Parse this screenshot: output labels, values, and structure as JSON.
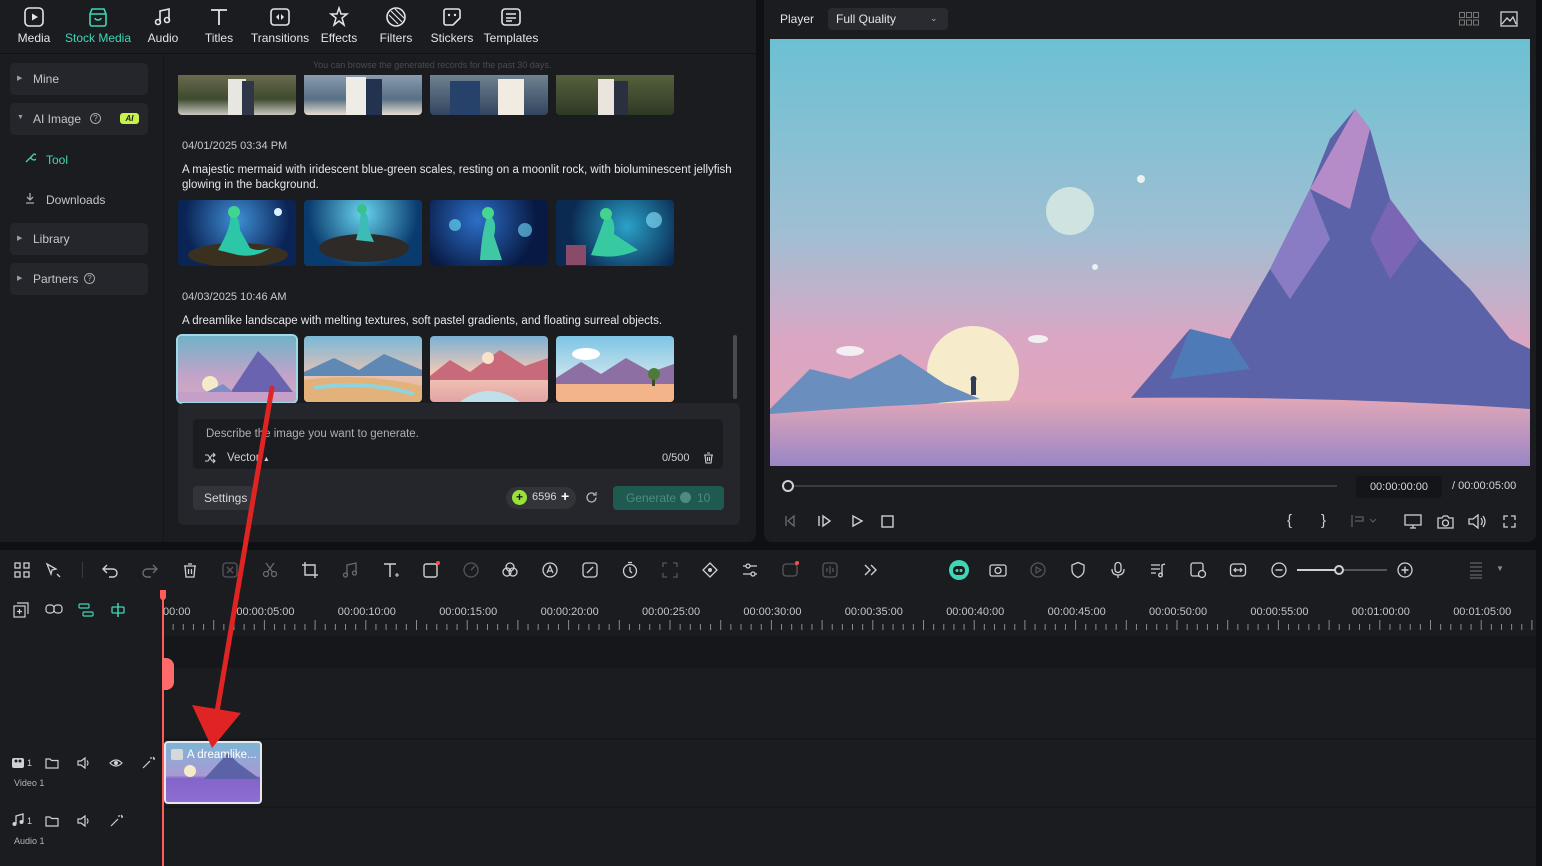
{
  "nav": {
    "items": [
      {
        "label": "Media",
        "icon": "media-icon"
      },
      {
        "label": "Stock Media",
        "icon": "stock-media-icon",
        "active": true
      },
      {
        "label": "Audio",
        "icon": "audio-icon"
      },
      {
        "label": "Titles",
        "icon": "titles-icon"
      },
      {
        "label": "Transitions",
        "icon": "transitions-icon"
      },
      {
        "label": "Effects",
        "icon": "effects-icon"
      },
      {
        "label": "Filters",
        "icon": "filters-icon"
      },
      {
        "label": "Stickers",
        "icon": "stickers-icon"
      },
      {
        "label": "Templates",
        "icon": "templates-icon"
      }
    ]
  },
  "sidebar": {
    "mine": "Mine",
    "ai_image": "AI Image",
    "ai_badge": "AI",
    "tool": "Tool",
    "downloads": "Downloads",
    "library": "Library",
    "partners": "Partners"
  },
  "content": {
    "history_note": "You can browse the generated records for the past 30 days.",
    "groups": [
      {
        "timestamp": "04/01/2025 03:34 PM",
        "prompt": "A majestic mermaid with iridescent blue-green scales, resting on a moonlit rock, with bioluminescent jellyfish glowing in the background."
      },
      {
        "timestamp": "04/03/2025 10:46 AM",
        "prompt": "A dreamlike landscape with melting textures, soft pastel gradients, and floating surreal objects."
      }
    ]
  },
  "generator": {
    "placeholder": "Describe the image you want to generate.",
    "style": "Vector",
    "counter": "0/500",
    "settings": "Settings",
    "credits": "6596",
    "generate": "Generate",
    "generate_cost": "10"
  },
  "player": {
    "label": "Player",
    "quality": "Full Quality",
    "current_time": "00:00:00:00",
    "total_time": "/  00:00:05:00"
  },
  "timeline": {
    "ruler": [
      "00:00",
      "00:00:05:00",
      "00:00:10:00",
      "00:00:15:00",
      "00:00:20:00",
      "00:00:25:00",
      "00:00:30:00",
      "00:00:35:00",
      "00:00:40:00",
      "00:00:45:00",
      "00:00:50:00",
      "00:00:55:00",
      "00:01:00:00",
      "00:01:05:00"
    ],
    "video_track": "Video 1",
    "audio_track": "Audio 1",
    "track_index": "1",
    "clip_label": "A dreamlike..."
  },
  "colors": {
    "accent": "#3fd6b6",
    "annotation_arrow": "#e02424",
    "playhead": "#ff5c5c"
  }
}
